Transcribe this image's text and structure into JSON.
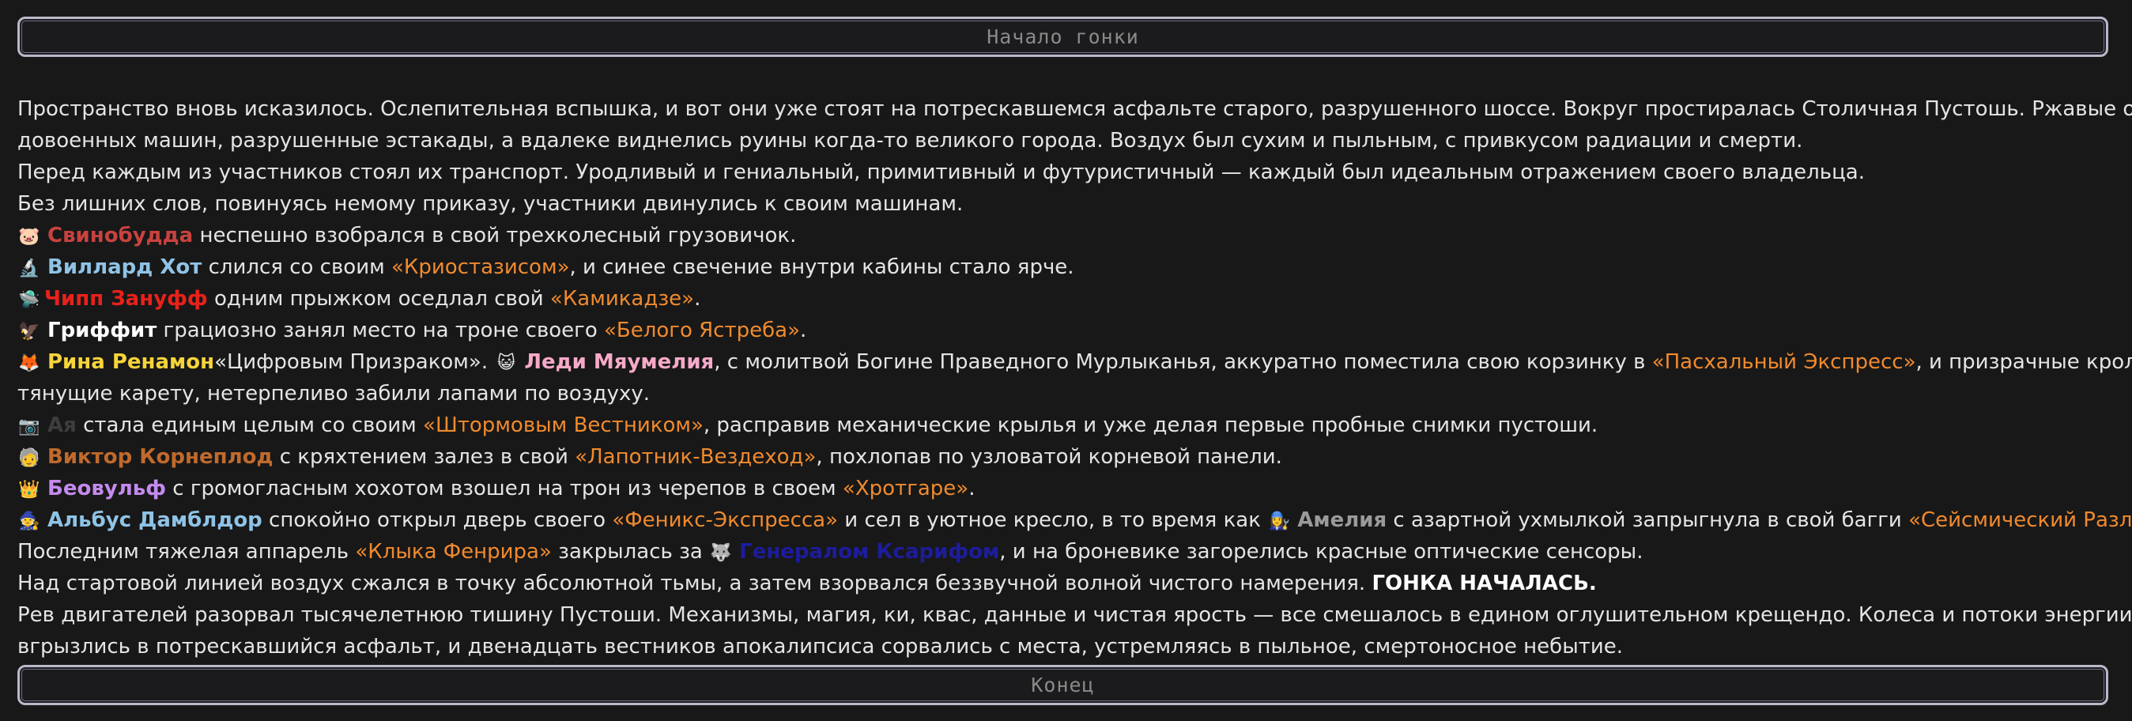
{
  "header": {
    "title": "Начало гонки"
  },
  "footer": {
    "title": "Конец"
  },
  "story": {
    "p1a": "Пространство вновь исказилось. Ослепительная вспышка, и вот они уже стоят на потрескавшемся асфальте старого, разрушенного шоссе. Вокруг простиралась Столичная Пустошь. Ржавые остовы",
    "p1b": "довоенных машин, разрушенные эстакады, а вдалеке виднелись руины когда-то великого города. Воздух был сухим и пыльным, с привкусом радиации и смерти.",
    "p2": "Перед каждым из участников стоял их транспорт. Уродливый и гениальный, примитивный и футуристичный — каждый был идеальным отражением своего владельца.",
    "p3": "Без лишних слов, повинуясь немому приказу, участники двинулись к своим машинам.",
    "svin": {
      "emoji": "🐷",
      "name": "Свинобудда",
      "text": " неспешно взобрался в свой трехколесный грузовичок."
    },
    "hot": {
      "emoji": "🔬",
      "name": "Виллард Хот",
      "text1": " слился со своим ",
      "vehicle": "«Криостазисом»",
      "text2": ", и синее свечение внутри кабины стало ярче."
    },
    "chipp": {
      "emoji": "🛸",
      "name": "Чипп Зануфф",
      "text1": " одним прыжком оседлал свой ",
      "vehicle": "«Камикадзе»",
      "text2": "."
    },
    "griff": {
      "emoji": "🦅",
      "name": "Гриффит",
      "text1": " грациозно занял место на троне своего ",
      "vehicle": "«Белого Ястреба»",
      "text2": "."
    },
    "rina": {
      "emoji": "🦊",
      "name": "Рина Ренамон",
      "text1": "«Цифровым Призраком». "
    },
    "miau": {
      "emoji": "😺",
      "name": "Леди Мяумелия",
      "text1": ", с молитвой Богине Праведного Мурлыканья, аккуратно поместила свою корзинку в ",
      "vehicle": "«Пасхальный Экспресс»",
      "text2": ", и призрачные кролики,",
      "text3": "тянущие карету, нетерпеливо забили лапами по воздуху."
    },
    "aya": {
      "emoji": "📷",
      "name": "Ая",
      "text1": " стала единым целым со своим ",
      "vehicle": "«Штормовым Вестником»",
      "text2": ", расправив механические крылья и уже делая первые пробные снимки пустоши."
    },
    "viktor": {
      "emoji": "🧓",
      "name": "Виктор Корнеплод",
      "text1": " с кряхтением залез в свой ",
      "vehicle": "«Лапотник-Вездеход»",
      "text2": ", похлопав по узловатой корневой панели."
    },
    "beo": {
      "emoji": "👑",
      "name": "Беовульф",
      "text1": " с громогласным хохотом взошел на трон из черепов в своем ",
      "vehicle": "«Хротгаре»",
      "text2": "."
    },
    "alb": {
      "emoji": "🧙",
      "name": "Альбус Дамблдор",
      "text1": " спокойно открыл дверь своего ",
      "vehicle": "«Феникс-Экспресса»",
      "text2": " и сел в уютное кресло, в то время как "
    },
    "amel": {
      "emoji": "👩‍🔧",
      "name": "Амелия",
      "text1": " с азартной ухмылкой запрыгнула в свой багги ",
      "vehicle": "«Сейсмический Разлом»",
      "text2": "."
    },
    "last": {
      "text1": "Последним тяжелая аппарель ",
      "vehicle": "«Клыка Фенрира»",
      "text2": " закрылась за ",
      "emoji": "🐺",
      "name": "Генералом Ксарифом",
      "text3": ", и на броневике загорелись красные оптические сенсоры."
    },
    "p4a": "Над стартовой линией воздух сжался в точку абсолютной тьмы, а затем взорвался беззвучной волной чистого намерения. ",
    "p4b": "ГОНКА НАЧАЛАСЬ.",
    "p5a": "Рев двигателей разорвал тысячелетнюю тишину Пустоши. Механизмы, магия, ки, квас, данные и чистая ярость — все смешалось в едином оглушительном крещендо. Колеса и потоки энергии",
    "p5b": "вгрызлись в потрескавшийся асфальт, и двенадцать вестников апокалипсиса сорвались с места, устремляясь в пыльное, смертоносное небытие."
  }
}
